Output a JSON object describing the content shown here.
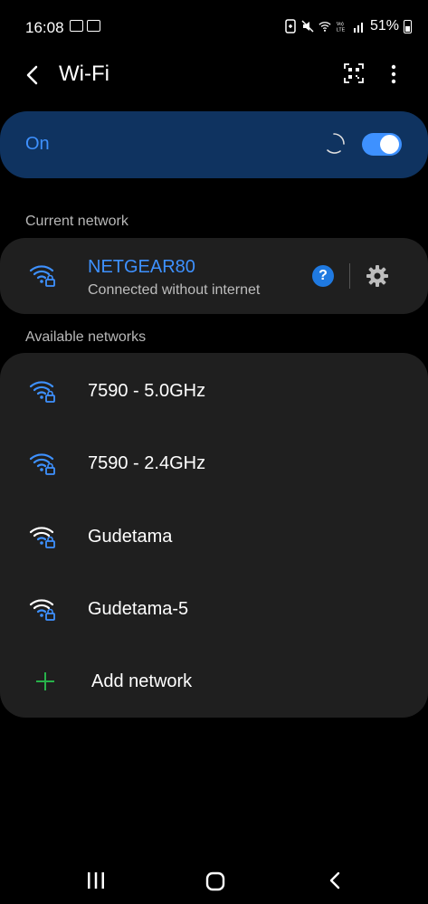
{
  "status_bar": {
    "time": "16:08",
    "battery": "51%",
    "left_icons": [
      "email-icon",
      "email-icon"
    ],
    "right_icons": [
      "battery-saver-icon",
      "mute-icon",
      "wifi-icon",
      "volte-icon",
      "signal-icon",
      "battery-icon"
    ]
  },
  "header": {
    "title": "Wi-Fi",
    "back_icon": "back-arrow-icon",
    "qr_icon": "qr-scan-icon",
    "more_icon": "more-vert-icon"
  },
  "master_toggle": {
    "label": "On",
    "state": "on",
    "scanning": true
  },
  "current_network": {
    "section_label": "Current network",
    "name": "NETGEAR80",
    "status": "Connected without internet",
    "help_symbol": "?"
  },
  "available_networks": {
    "section_label": "Available networks",
    "items": [
      {
        "name": "7590 - 5.0GHz",
        "secured": true
      },
      {
        "name": "7590 - 2.4GHz",
        "secured": true
      },
      {
        "name": "Gudetama",
        "secured": true
      },
      {
        "name": "Gudetama-5",
        "secured": true
      }
    ],
    "add_label": "Add network"
  },
  "colors": {
    "accent": "#3e91ff",
    "toggle_bar": "#0f3360",
    "card": "#1f1f1f",
    "add": "#27b24a"
  }
}
